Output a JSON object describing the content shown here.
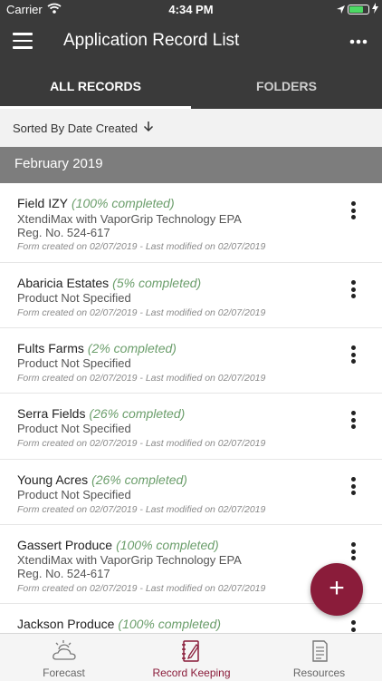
{
  "status_bar": {
    "carrier": "Carrier",
    "time": "4:34 PM",
    "battery_level": 0.75,
    "battery_color": "#4cd964"
  },
  "app_bar": {
    "title": "Application Record List",
    "menu_icon": "hamburger-icon",
    "more_icon": "more-horizontal-icon",
    "background": "#3a3a3a"
  },
  "tabs": [
    {
      "label": "ALL RECORDS",
      "active": true
    },
    {
      "label": "FOLDERS",
      "active": false
    }
  ],
  "sort": {
    "label": "Sorted By Date Created",
    "direction_icon": "arrow-down-icon"
  },
  "section": {
    "label": "February 2019"
  },
  "records": [
    {
      "name": "Field IZY",
      "progress": "(100% completed)",
      "product": "XtendiMax with VaporGrip Technology EPA",
      "product2": "Reg. No. 524-617",
      "meta": "Form created on 02/07/2019 - Last modified on 02/07/2019"
    },
    {
      "name": "Abaricia Estates",
      "progress": "(5% completed)",
      "product": "Product Not Specified",
      "product2": "",
      "meta": "Form created on 02/07/2019 - Last modified on 02/07/2019"
    },
    {
      "name": "Fults Farms",
      "progress": "(2% completed)",
      "product": "Product Not Specified",
      "product2": "",
      "meta": "Form created on 02/07/2019 - Last modified on 02/07/2019"
    },
    {
      "name": "Serra Fields",
      "progress": "(26% completed)",
      "product": "Product Not Specified",
      "product2": "",
      "meta": "Form created on 02/07/2019 - Last modified on 02/07/2019"
    },
    {
      "name": "Young Acres",
      "progress": "(26% completed)",
      "product": "Product Not Specified",
      "product2": "",
      "meta": "Form created on 02/07/2019 - Last modified on 02/07/2019"
    },
    {
      "name": "Gassert Produce",
      "progress": "(100% completed)",
      "product": "XtendiMax with VaporGrip Technology EPA",
      "product2": "Reg. No. 524-617",
      "meta": "Form created on 02/07/2019 - Last modified on 02/07/2019"
    },
    {
      "name": "Jackson Produce",
      "progress": "(100% completed)",
      "product": "",
      "product2": "",
      "meta": ""
    }
  ],
  "fab": {
    "symbol": "+",
    "icon": "plus-icon",
    "color": "#8a1c3a"
  },
  "bottom_nav": [
    {
      "label": "Forecast",
      "icon": "cloud-sun-icon",
      "active": false
    },
    {
      "label": "Record Keeping",
      "icon": "notebook-pen-icon",
      "active": true
    },
    {
      "label": "Resources",
      "icon": "document-icon",
      "active": false
    }
  ],
  "colors": {
    "accent": "#8a1c3a",
    "progress_text": "#6b9e6b",
    "section_bg": "#7d7d7d"
  }
}
